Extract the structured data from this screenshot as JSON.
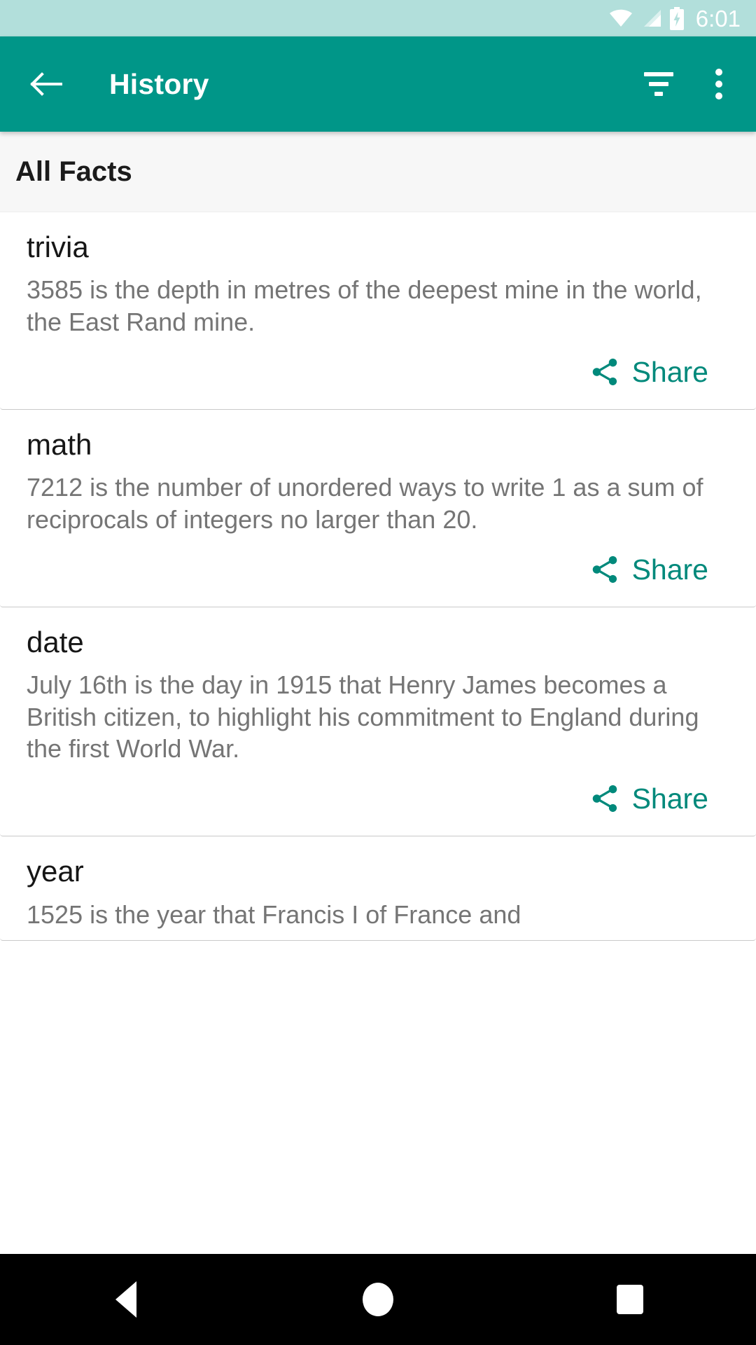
{
  "status_bar": {
    "time": "6:01",
    "background": "#b2dfdb",
    "icons": [
      "wifi-icon",
      "cellular-signal-icon",
      "battery-charging-icon"
    ]
  },
  "app_bar": {
    "title": "History",
    "background": "#009688",
    "back_icon": "arrow-back-icon",
    "filter_icon": "filter-list-icon",
    "overflow_icon": "more-vert-icon"
  },
  "section": {
    "title": "All Facts"
  },
  "share": {
    "label": "Share",
    "color": "#00897b",
    "icon": "share-icon"
  },
  "facts": [
    {
      "type": "trivia",
      "text": "3585 is the depth in metres of the deepest mine in the world, the East Rand mine."
    },
    {
      "type": "math",
      "text": "7212 is the number of unordered ways to write 1 as a sum of reciprocals of integers no larger than 20."
    },
    {
      "type": "date",
      "text": "July 16th is the day in 1915 that Henry James becomes a British citizen, to highlight his commitment to England during the first World War."
    },
    {
      "type": "year",
      "text": "1525 is the year that Francis I of France and"
    }
  ],
  "nav_bar": {
    "background": "#000000",
    "buttons": [
      "back-triangle-icon",
      "home-circle-icon",
      "recents-square-icon"
    ]
  }
}
